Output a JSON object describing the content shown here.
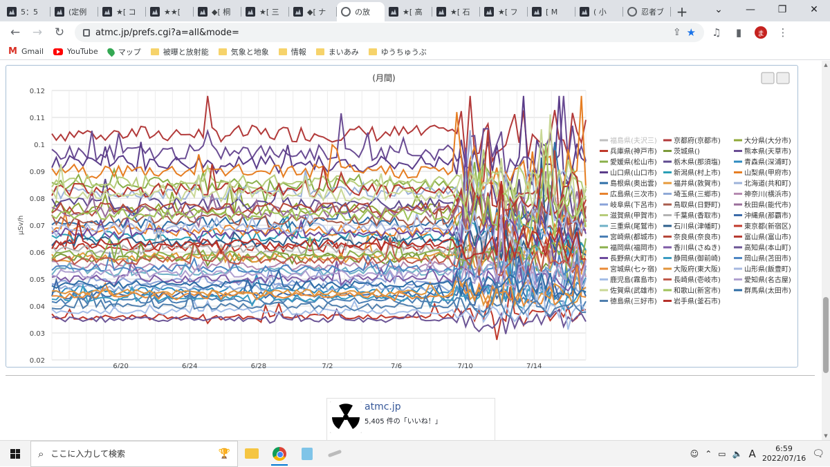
{
  "browser": {
    "tabs": [
      {
        "title": "5：5",
        "icon": "site-icon"
      },
      {
        "title": "(定例",
        "icon": "site-icon"
      },
      {
        "title": "★[ コ",
        "icon": "site-icon"
      },
      {
        "title": "★★[",
        "icon": "site-icon"
      },
      {
        "title": "◆[ 桐",
        "icon": "site-icon"
      },
      {
        "title": "★[ 三",
        "icon": "site-icon"
      },
      {
        "title": "◆[ ナ",
        "icon": "site-icon"
      },
      {
        "title": "の放",
        "icon": "globe-icon",
        "active": true
      },
      {
        "title": "★[ 高",
        "icon": "site-icon"
      },
      {
        "title": "★[ 石",
        "icon": "site-icon"
      },
      {
        "title": "★[ フ",
        "icon": "site-icon"
      },
      {
        "title": "[ M",
        "icon": "site-icon"
      },
      {
        "title": "( 小",
        "icon": "site-icon"
      },
      {
        "title": "忍者ブ",
        "icon": "globe-icon"
      }
    ],
    "url": "atmc.jp/prefs.cgi?a=all&mode=",
    "profile_initial": "ま",
    "bookmarks": [
      {
        "label": "Gmail",
        "icon": "gmail-icon"
      },
      {
        "label": "YouTube",
        "icon": "youtube-icon"
      },
      {
        "label": "マップ",
        "icon": "maps-icon"
      },
      {
        "label": "被曝と放射能",
        "icon": "folder-icon"
      },
      {
        "label": "気象と地象",
        "icon": "folder-icon"
      },
      {
        "label": "情報",
        "icon": "folder-icon"
      },
      {
        "label": "まいあみ",
        "icon": "folder-icon"
      },
      {
        "label": "ゆうちゅうぶ",
        "icon": "folder-icon"
      }
    ]
  },
  "chart_data": {
    "type": "line",
    "title": "(月間)",
    "ylabel": "µSv/h",
    "xlabel": "",
    "ylim": [
      0.02,
      0.12
    ],
    "yticks": [
      "0.02",
      "0.03",
      "0.04",
      "0.05",
      "0.06",
      "0.07",
      "0.08",
      "0.09",
      "0.1",
      "0.11",
      "0.12"
    ],
    "xticks": [
      "6/20",
      "6/24",
      "6/28",
      "7/2",
      "7/6",
      "7/10",
      "7/14"
    ],
    "grid": true,
    "legend_position": "right",
    "series": [
      {
        "name": "福島県(夫沢三)",
        "color": "#bfbfbf",
        "base": null
      },
      {
        "name": "京都府(京都市)",
        "color": "#b23a3a",
        "base": 0.104
      },
      {
        "name": "大分県(大分市)",
        "color": "#8fa838",
        "base": 0.076
      },
      {
        "name": "兵庫県(神戸市)",
        "color": "#c0392b",
        "base": 0.062
      },
      {
        "name": "茨城県()",
        "color": "#7b9a3a",
        "base": 0.058
      },
      {
        "name": "熊本県(天草市)",
        "color": "#6a4c93",
        "base": 0.097
      },
      {
        "name": "愛媛県(松山市)",
        "color": "#8ab04a",
        "base": 0.085
      },
      {
        "name": "栃木県(那須塩)",
        "color": "#5e4a8f",
        "base": 0.078
      },
      {
        "name": "青森県(深浦町)",
        "color": "#2e8bc0",
        "base": 0.046
      },
      {
        "name": "山口県(山口市)",
        "color": "#5b3d8a",
        "base": 0.093
      },
      {
        "name": "新潟県(村上市)",
        "color": "#2a9fb6",
        "base": 0.066
      },
      {
        "name": "山梨県(甲府市)",
        "color": "#e67e22",
        "base": 0.09
      },
      {
        "name": "島根県(奥出雲)",
        "color": "#2e6fa8",
        "base": 0.071
      },
      {
        "name": "福井県(敦賀市)",
        "color": "#e69a3b",
        "base": 0.058
      },
      {
        "name": "北海道(共和町)",
        "color": "#9db3d9",
        "base": 0.082
      },
      {
        "name": "広島県(三次市)",
        "color": "#e8832e",
        "base": 0.068
      },
      {
        "name": "埼玉県(三郷市)",
        "color": "#8fa9d6",
        "base": 0.047
      },
      {
        "name": "神奈川(横浜市)",
        "color": "#b58ab0",
        "base": 0.055
      },
      {
        "name": "岐阜県(下呂市)",
        "color": "#8aa3d9",
        "base": 0.049
      },
      {
        "name": "鳥取県(日野町)",
        "color": "#a85c4e",
        "base": 0.072
      },
      {
        "name": "秋田県(能代市)",
        "color": "#9a6e9a",
        "base": 0.075
      },
      {
        "name": "滋賀県(甲賀市)",
        "color": "#b6cc7a",
        "base": 0.086
      },
      {
        "name": "千葉県(香取市)",
        "color": "#b3b3b3",
        "base": 0.061
      },
      {
        "name": "沖縄県(那覇市)",
        "color": "#3b6aa8",
        "base": 0.044
      },
      {
        "name": "三重県(尾鷲市)",
        "color": "#6fb1c7",
        "base": 0.053
      },
      {
        "name": "石川県(津幡町)",
        "color": "#2e5f8c",
        "base": 0.064
      },
      {
        "name": "東京都(新宿区)",
        "color": "#c0392b",
        "base": 0.036
      },
      {
        "name": "宮崎県(都城市)",
        "color": "#4a7fb5",
        "base": 0.042
      },
      {
        "name": "奈良県(奈良市)",
        "color": "#b5473a",
        "base": 0.076
      },
      {
        "name": "富山県(富山市)",
        "color": "#b73a30",
        "base": 0.083
      },
      {
        "name": "福岡県(福岡市)",
        "color": "#8bb04d",
        "base": 0.059
      },
      {
        "name": "香川県(さぬき)",
        "color": "#7d5aa6",
        "base": 0.05
      },
      {
        "name": "高知県(本山町)",
        "color": "#6b5495",
        "base": 0.035
      },
      {
        "name": "長野県(大町市)",
        "color": "#6d4a9e",
        "base": 0.067
      },
      {
        "name": "静岡県(御前崎)",
        "color": "#3a9cc2",
        "base": 0.043
      },
      {
        "name": "岡山県(苫田市)",
        "color": "#4d86c4",
        "base": 0.054
      },
      {
        "name": "宮城県(七ヶ宿)",
        "color": "#e98a36",
        "base": 0.044
      },
      {
        "name": "大阪府(東大阪)",
        "color": "#e0953c",
        "base": 0.045
      },
      {
        "name": "山形県(飯豊町)",
        "color": "#a6b8e0",
        "base": 0.069
      },
      {
        "name": "鹿児島(霧島市)",
        "color": "#a4bde6",
        "base": 0.038
      },
      {
        "name": "長崎県(壱岐市)",
        "color": "#c05a4b",
        "base": 0.057
      },
      {
        "name": "愛知県(名古屋)",
        "color": "#b0a0d0",
        "base": 0.052
      },
      {
        "name": "佐賀県(武雄市)",
        "color": "#c9d896",
        "base": 0.081
      },
      {
        "name": "和歌山(新宮市)",
        "color": "#9fc25a",
        "base": 0.074
      },
      {
        "name": "群馬県(太田市)",
        "color": "#2e6ca5",
        "base": 0.048
      },
      {
        "name": "徳島県(三好市)",
        "color": "#4f7fae",
        "base": 0.04
      },
      {
        "name": "岩手県(釜石市)",
        "color": "#b5312a",
        "base": 0.063
      }
    ]
  },
  "social": {
    "title": "atmc.jp",
    "likes": "5,405 件の「いいね！」"
  },
  "taskbar": {
    "search_placeholder": "ここに入力して検索",
    "ime": "A",
    "time": "6:59",
    "date": "2022/07/16"
  }
}
